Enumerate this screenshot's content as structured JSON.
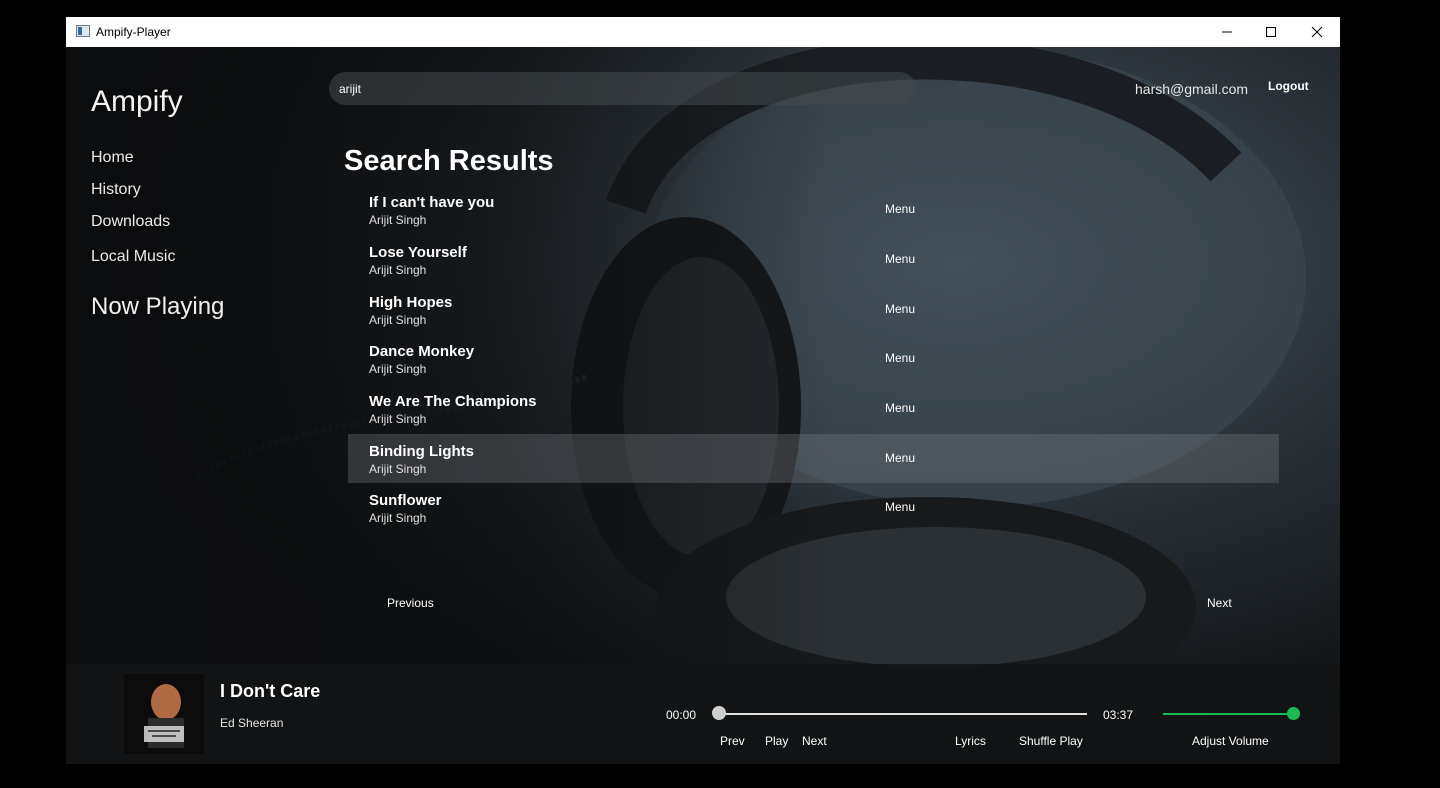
{
  "window": {
    "title": "Ampify-Player"
  },
  "sidebar": {
    "brand": "Ampify",
    "items": [
      {
        "label": "Home"
      },
      {
        "label": "History"
      },
      {
        "label": "Downloads"
      },
      {
        "label": "Local Music"
      }
    ],
    "now_playing": "Now Playing"
  },
  "header": {
    "search_value": "arijit",
    "user_email": "harsh@gmail.com",
    "logout_label": "Logout"
  },
  "results": {
    "title": "Search Results",
    "menu_label": "Menu",
    "items": [
      {
        "title": "If I can't have you",
        "artist": "Arijit Singh"
      },
      {
        "title": "Lose Yourself",
        "artist": "Arijit Singh"
      },
      {
        "title": "High Hopes",
        "artist": "Arijit Singh"
      },
      {
        "title": "Dance Monkey",
        "artist": "Arijit Singh"
      },
      {
        "title": "We Are The Champions",
        "artist": "Arijit Singh"
      },
      {
        "title": "Binding Lights",
        "artist": "Arijit Singh",
        "selected": true
      },
      {
        "title": "Sunflower",
        "artist": "Arijit Singh"
      }
    ]
  },
  "pagination": {
    "previous": "Previous",
    "next": "Next"
  },
  "player": {
    "title": "I Don't Care",
    "artist": "Ed Sheeran",
    "time_current": "00:00",
    "time_total": "03:37",
    "progress": 0.0,
    "volume": 1.0,
    "controls": {
      "prev": "Prev",
      "play": "Play",
      "next": "Next",
      "lyrics": "Lyrics",
      "shuffle": "Shuffle Play",
      "volume": "Adjust Volume"
    }
  },
  "colors": {
    "accent": "#1db954",
    "background": "#0e1012",
    "text": "#ffffff"
  }
}
